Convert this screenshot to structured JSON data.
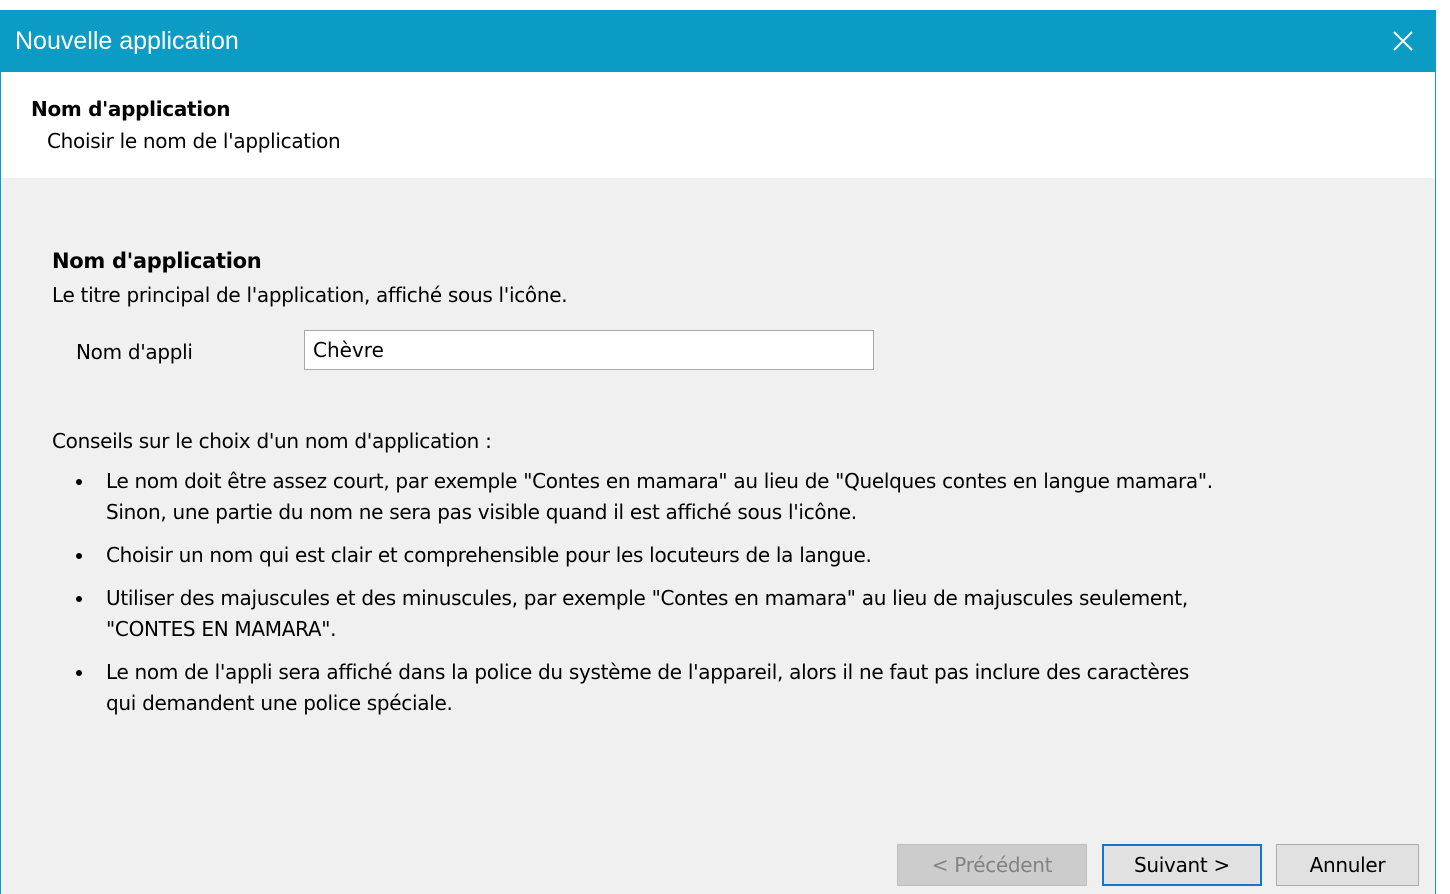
{
  "window": {
    "title": "Nouvelle application",
    "close_icon": "close-icon"
  },
  "header": {
    "title": "Nom d'application",
    "subtitle": "Choisir le nom de l'application"
  },
  "section": {
    "title": "Nom d'application",
    "description": "Le titre principal de l'application, affiché sous l'icône.",
    "field_label": "Nom d'appli",
    "field_value": "Chèvre"
  },
  "tips": {
    "intro": "Conseils sur le choix d'un nom d'application :",
    "items": [
      {
        "line1": "Le nom doit être assez court, par exemple \"Contes en mamara\" au lieu de \"Quelques contes en langue mamara\".",
        "line2": "Sinon, une partie du nom ne sera pas visible quand il est affiché sous l'icône."
      },
      {
        "line1": "Choisir un nom qui est clair et comprehensible pour les locuteurs de la langue.",
        "line2": ""
      },
      {
        "line1": "Utiliser des majuscules et des minuscules, par exemple \"Contes en mamara\" au lieu de majuscules seulement,",
        "line2": "\"CONTES EN MAMARA\"."
      },
      {
        "line1": "Le nom de l'appli sera affiché dans la police du système de l'appareil, alors il ne faut pas inclure des caractères",
        "line2": "qui demandent une police spéciale."
      }
    ]
  },
  "buttons": {
    "previous": "< Précédent",
    "next": "Suivant >",
    "cancel": "Annuler"
  },
  "colors": {
    "titlebar": "#0b9bc4",
    "focus_border": "#0b78d7"
  }
}
